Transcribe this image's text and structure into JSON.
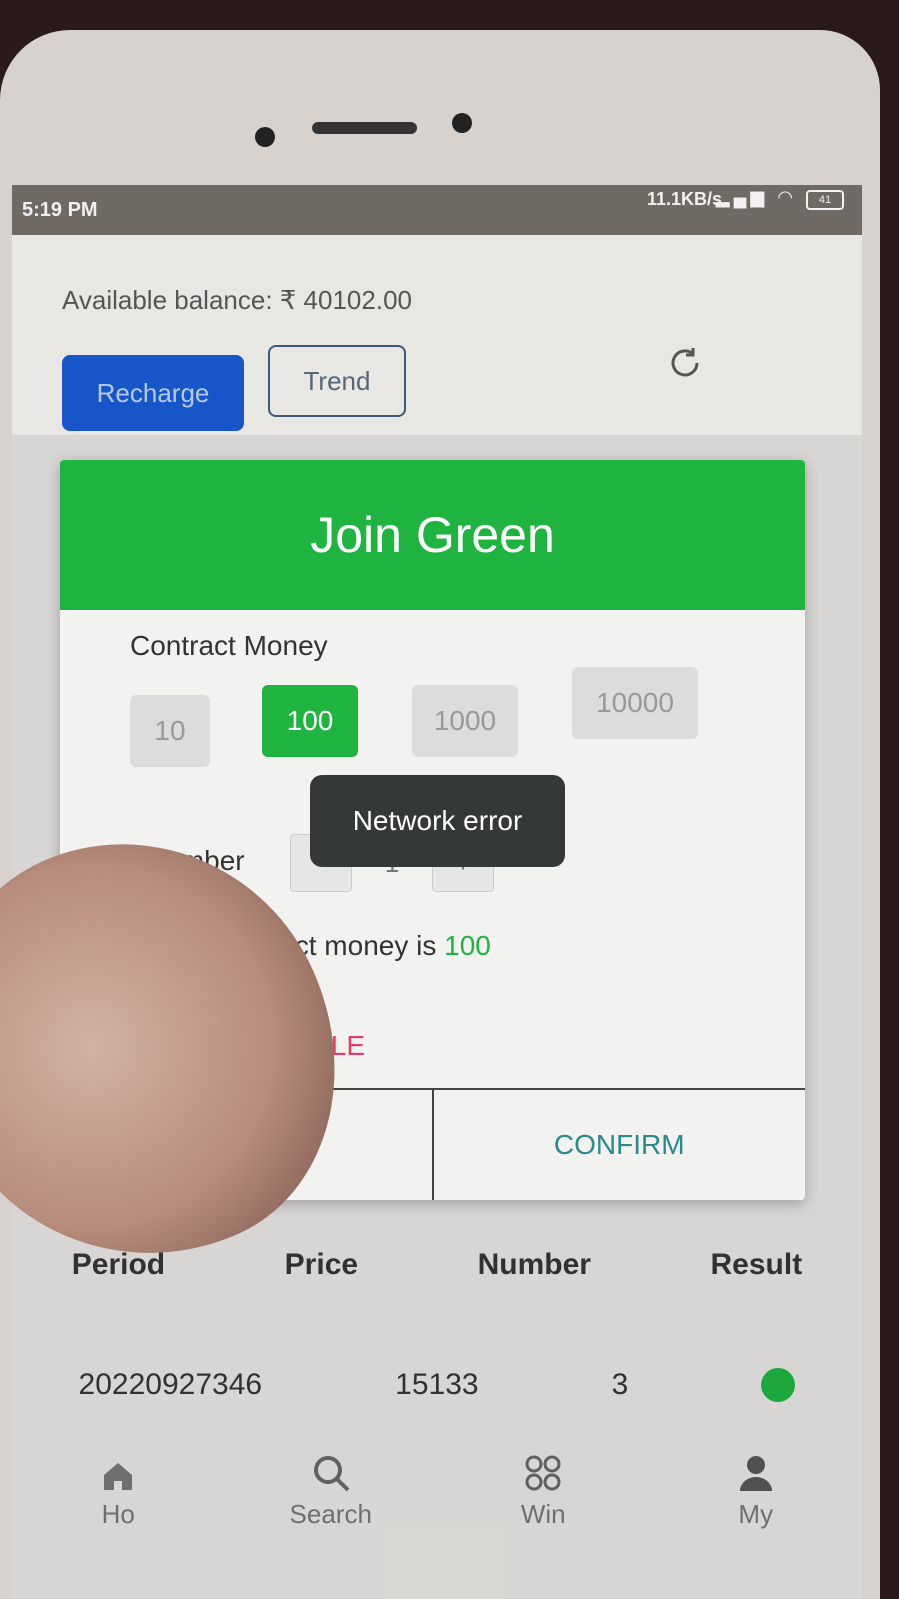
{
  "status_bar": {
    "time": "5:19 PM",
    "network_speed": "11.1KB/s",
    "battery": "41"
  },
  "header": {
    "balance_text": "Available balance: ₹ 40102.00",
    "recharge_label": "Recharge",
    "trend_label": "Trend",
    "refresh_icon": "refresh-icon"
  },
  "dialog": {
    "title": "Join Green",
    "contract_label": "Contract Money",
    "amount_options": [
      "10",
      "100",
      "1000",
      "10000"
    ],
    "selected_amount": "100",
    "number_label": "Number",
    "number_value": "1",
    "minus_label": "−",
    "plus_label": "+",
    "total_prefix": "Total contract money is ",
    "total_value": "100",
    "agree_prefix": "e ",
    "rule_label": "PRESALE RULE",
    "cancel_label": "CEL",
    "confirm_label": "CONFIRM",
    "accent_color": "#1fb440"
  },
  "toast": {
    "message": "Network error"
  },
  "table": {
    "columns": [
      "Period",
      "Price",
      "Number",
      "Result"
    ],
    "rows": [
      {
        "period": "20220927346",
        "price": "15133",
        "number": "3",
        "result_color": "#1fb440"
      }
    ]
  },
  "bottom_nav": {
    "items": [
      {
        "label": "Ho",
        "icon": "home-icon"
      },
      {
        "label": "Search",
        "icon": "search-icon"
      },
      {
        "label": "Win",
        "icon": "grid-icon"
      },
      {
        "label": "My",
        "icon": "person-icon"
      }
    ]
  }
}
